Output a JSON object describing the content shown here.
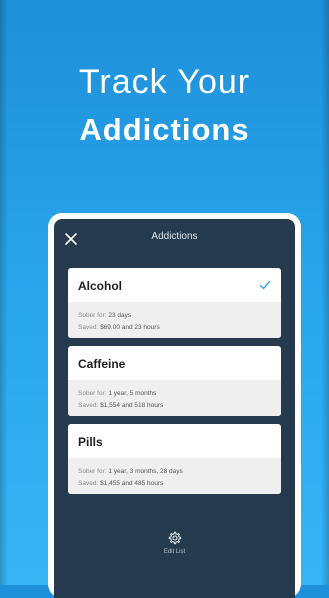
{
  "promo": {
    "line1": "Track Your",
    "line2": "Addictions"
  },
  "appbar": {
    "title": "Addictions",
    "close_icon": "close-icon"
  },
  "addictions": [
    {
      "name": "Alcohol",
      "selected": true,
      "sober_label": "Sober for:",
      "sober_value": "23 days",
      "saved_label": "Saved:",
      "saved_value": "$69.00 and 23 hours"
    },
    {
      "name": "Caffeine",
      "selected": false,
      "sober_label": "Sober for:",
      "sober_value": "1 year, 5 months",
      "saved_label": "Saved:",
      "saved_value": "$1,554 and 518 hours"
    },
    {
      "name": "Pills",
      "selected": false,
      "sober_label": "Sober for:",
      "sober_value": "1 year, 3 months, 28 days",
      "saved_label": "Saved:",
      "saved_value": "$1,455 and 485 hours"
    }
  ],
  "footer": {
    "edit_label": "Edit List",
    "icon": "gear-icon"
  },
  "colors": {
    "background_top": "#1e8fd9",
    "background_bottom": "#36b4f4",
    "screen": "#263a4d",
    "accent_check": "#3aa0e8"
  }
}
